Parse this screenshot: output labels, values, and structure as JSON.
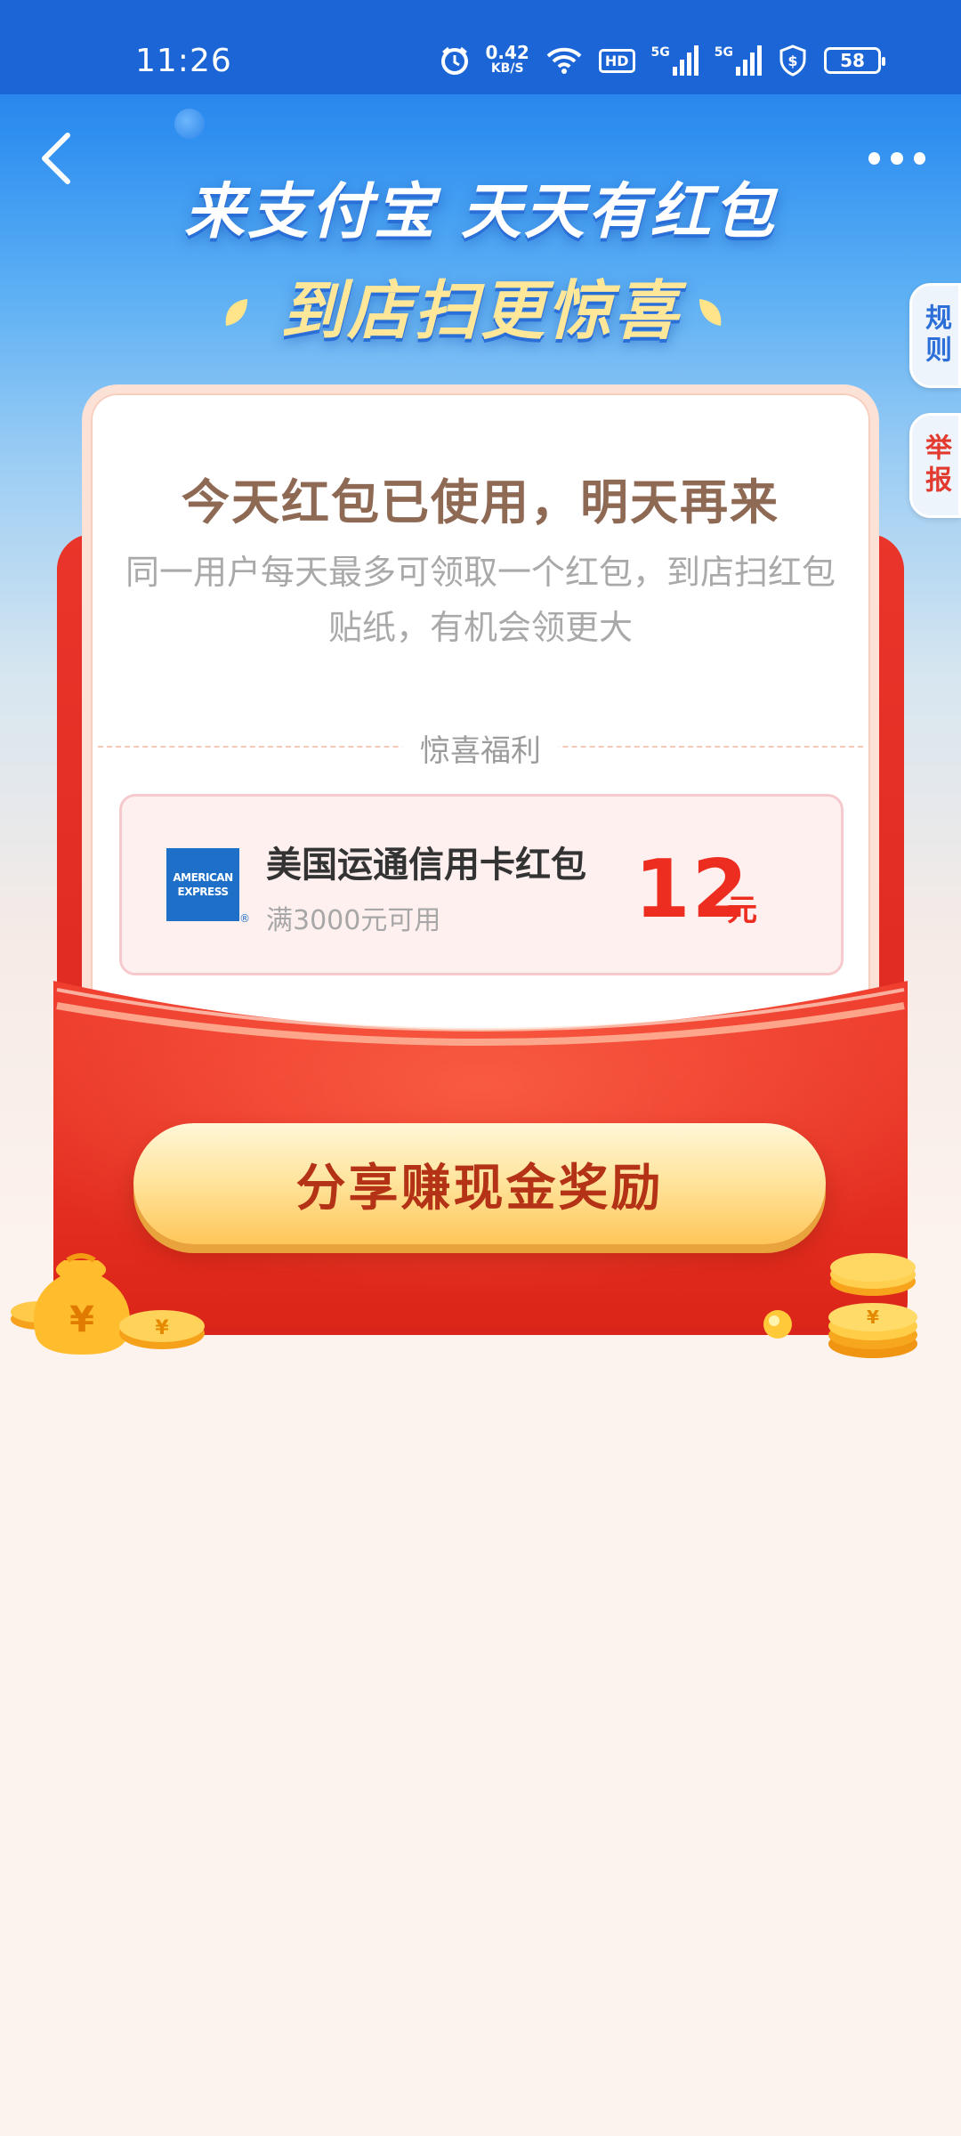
{
  "status_bar": {
    "time": "11:26",
    "net_speed_value": "0.42",
    "net_speed_unit": "KB/S",
    "hd_label": "HD",
    "sim1_label": "5G",
    "sim2_label": "5G",
    "battery": "58"
  },
  "header": {
    "back_icon": "chevron-left-icon",
    "more_icon": "more-dots-icon"
  },
  "hero": {
    "title": "来支付宝 天天有红包",
    "subtitle": "到店扫更惊喜"
  },
  "side_tabs": {
    "rules": "规则",
    "report": "举报"
  },
  "card": {
    "title": "今天红包已使用，明天再来",
    "description": "同一用户每天最多可领取一个红包，到店扫红包贴纸，有机会领更大",
    "section_label": "惊喜福利"
  },
  "coupon": {
    "logo_line1": "AMERICAN",
    "logo_line2": "EXPRESS",
    "name": "美国运通信用卡红包",
    "condition": "满3000元可用",
    "amount": "12",
    "unit": "元"
  },
  "share_button": {
    "label": "分享赚现金奖励"
  },
  "colors": {
    "status_bar": "#1b65d6",
    "envelope_red": "#e9352a",
    "amount_red": "#ec2d20",
    "button_gold": "#ffd57a",
    "button_text": "#b43215"
  }
}
